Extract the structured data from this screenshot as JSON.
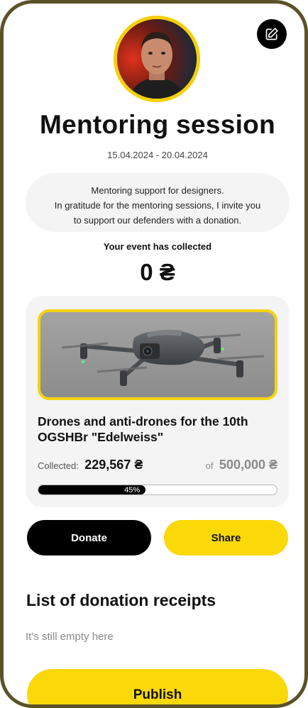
{
  "header": {
    "title": "Mentoring session",
    "dates": "15.04.2024 - 20.04.2024"
  },
  "description": {
    "lines": [
      "Mentoring support for designers.",
      "In gratitude for the mentoring sessions, I invite you",
      "to support our defenders with a donation."
    ]
  },
  "event": {
    "collected_label": "Your event has collected",
    "collected_amount": "0 ₴"
  },
  "fundraiser": {
    "title": "Drones and anti-drones for the 10th OGSHBr \"Edelweiss\"",
    "collected_label": "Collected:",
    "collected_amount": "229,567 ₴",
    "goal_label": "of",
    "goal_amount": "500,000 ₴",
    "progress_percent": 45,
    "progress_text": "45%"
  },
  "actions": {
    "donate_label": "Donate",
    "share_label": "Share",
    "publish_label": "Publish"
  },
  "receipts": {
    "title": "List of donation receipts",
    "empty_text": "It's still empty here"
  },
  "colors": {
    "accent_yellow": "#fbd808",
    "frame": "#5b5228",
    "card_bg": "#f4f4f4"
  },
  "icons": {
    "edit": "edit-icon"
  }
}
